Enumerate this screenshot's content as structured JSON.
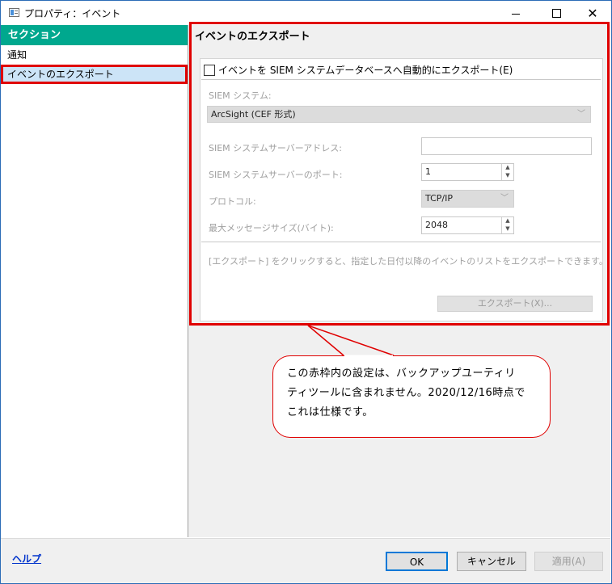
{
  "window": {
    "title": "プロパティ：イベント",
    "minimize_glyph": "minimize",
    "maximize_glyph": "maximize",
    "close_glyph": "✕"
  },
  "sidebar": {
    "header": "セクション",
    "items": [
      {
        "label": "通知",
        "selected": false
      },
      {
        "label": "イベントのエクスポート",
        "selected": true
      }
    ]
  },
  "section": {
    "title": "イベントのエクスポート",
    "auto_export_checkbox": {
      "label": "イベントを SIEM システムデータベースへ自動的にエクスポート(E)",
      "checked": false
    },
    "siem_system": {
      "label": "SIEM システム:",
      "value": "ArcSight (CEF 形式)"
    },
    "server_address": {
      "label": "SIEM システムサーバーアドレス:",
      "value": ""
    },
    "server_port": {
      "label": "SIEM システムサーバーのポート:",
      "value": "1"
    },
    "protocol": {
      "label": "プロトコル:",
      "value": "TCP/IP"
    },
    "max_message_size": {
      "label": "最大メッセージサイズ(バイト):",
      "value": "2048"
    },
    "hint": "[エクスポート] をクリックすると、指定した日付以降のイベントのリストをエクスポートできます。",
    "export_button": "エクスポート(X)..."
  },
  "footer": {
    "help_link": "ヘルプ",
    "ok": "OK",
    "cancel": "キャンセル",
    "apply": "適用(A)"
  },
  "callout": {
    "line1": "この赤枠内の設定は、バックアップユーティリ",
    "line2": "ティツールに含まれません。2020/12/16時点で",
    "line3": "これは仕様です。"
  },
  "colors": {
    "sidebar_header": "#00a88e",
    "selected_item": "#cce4f7",
    "annotation_red": "#e00000",
    "ok_border": "#0078d7"
  }
}
